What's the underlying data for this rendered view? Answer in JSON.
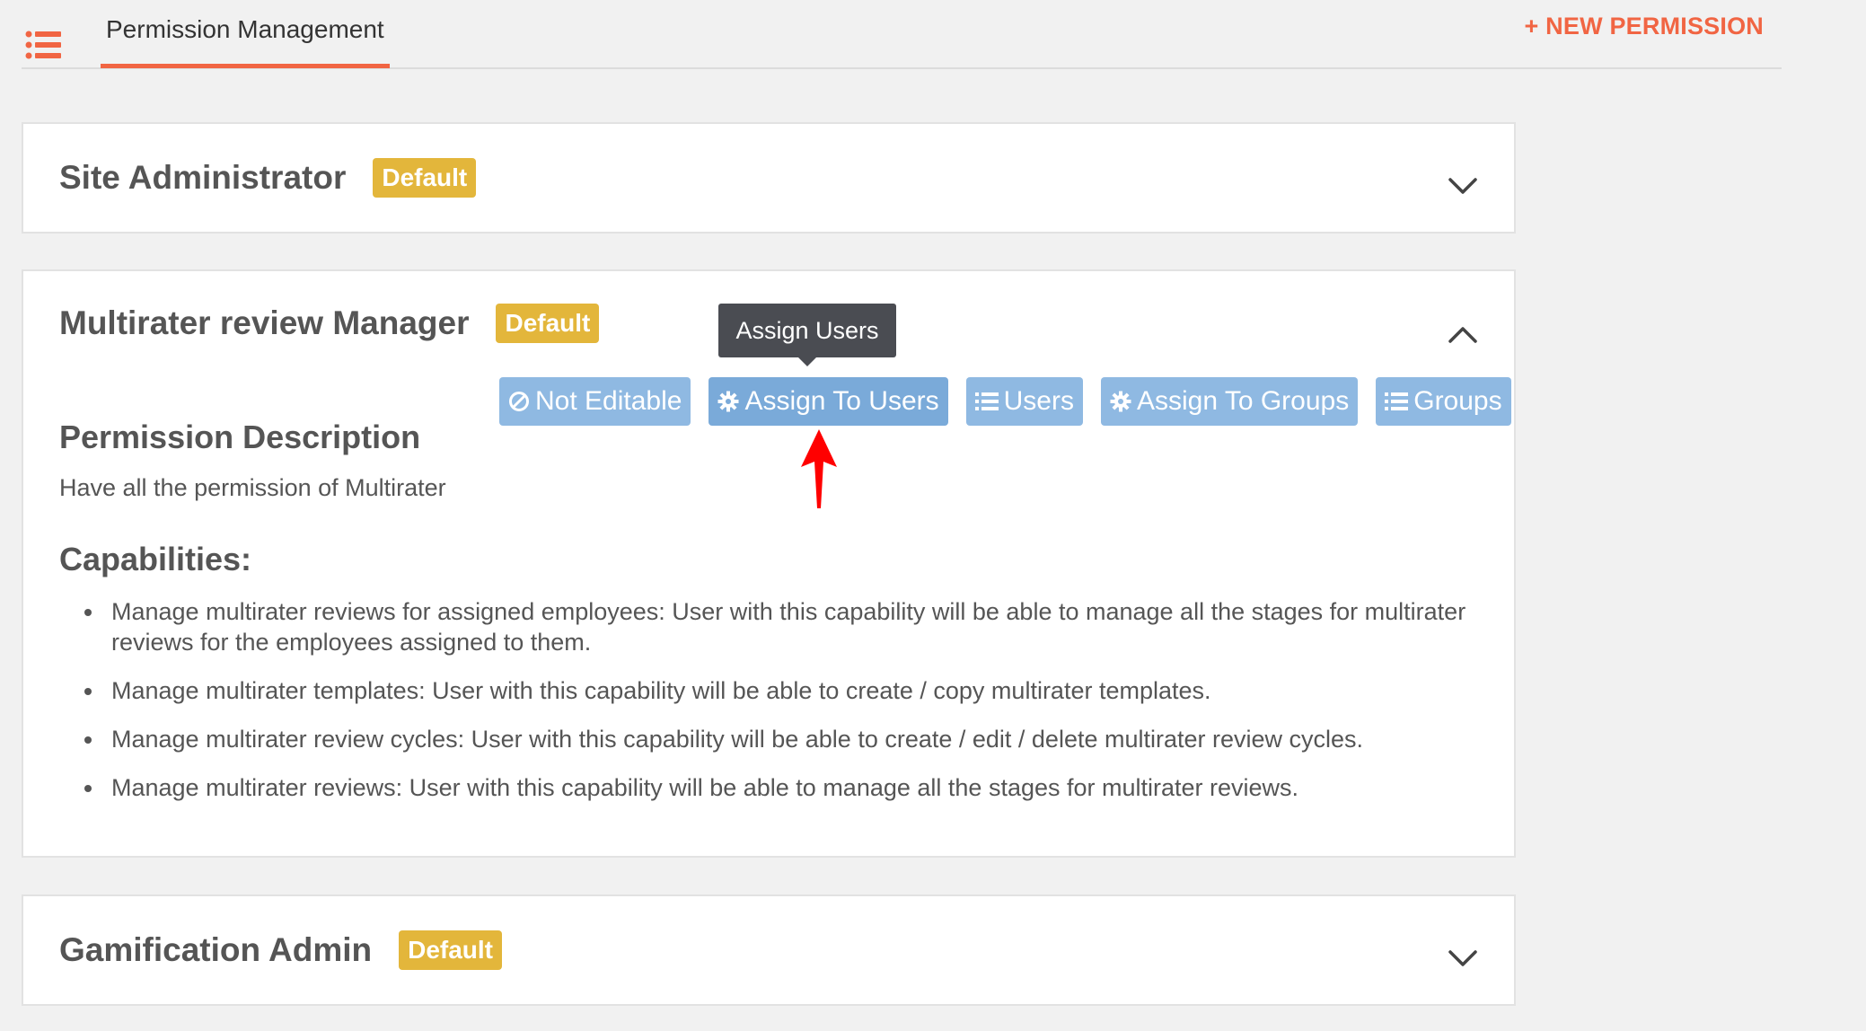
{
  "header": {
    "tab_label": "Permission Management",
    "new_permission_label": "+ NEW PERMISSION",
    "accent_color": "#f16543"
  },
  "permissions": [
    {
      "title": "Site Administrator",
      "badge": "Default",
      "expanded": false
    },
    {
      "title": "Multirater review Manager",
      "badge": "Default",
      "expanded": true,
      "actions": {
        "not_editable": "Not Editable",
        "assign_to_users": "Assign To Users",
        "users": "Users",
        "assign_to_groups": "Assign To Groups",
        "groups": "Groups"
      },
      "tooltip": "Assign Users",
      "description_title": "Permission Description",
      "description": "Have all the permission of Multirater",
      "capabilities_title": "Capabilities:",
      "capabilities": [
        "Manage multirater reviews for assigned employees: User with this capability will be able to manage all the stages for multirater reviews for the employees assigned to them.",
        "Manage multirater templates: User with this capability will be able to create / copy multirater templates.",
        "Manage multirater review cycles: User with this capability will be able to create / edit / delete multirater review cycles.",
        "Manage multirater reviews: User with this capability will be able to manage all the stages for multirater reviews."
      ]
    },
    {
      "title": "Gamification Admin",
      "badge": "Default",
      "expanded": false
    }
  ],
  "colors": {
    "badge": "#e3b63b",
    "action_button": "#8fb9e2",
    "tooltip": "#4a4c52",
    "annotation_arrow": "#ff0000"
  },
  "icons": {
    "menu": "list-icon",
    "not_editable": "ban-icon",
    "assign": "gear-icon",
    "list": "list-icon",
    "collapse": "chevron-up-icon",
    "expand": "chevron-down-icon"
  }
}
